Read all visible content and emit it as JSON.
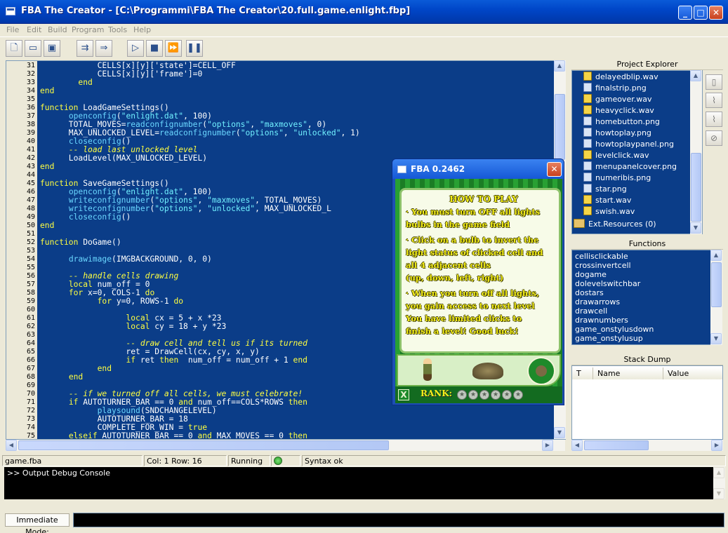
{
  "window": {
    "title": "FBA The Creator - [C:\\Programmi\\FBA The Creator\\20.full.game.enlight.fbp]",
    "min": "_",
    "max": "□",
    "close": "✕"
  },
  "menu": [
    "File",
    "Edit",
    "Build",
    "Program",
    "Tools",
    "Help"
  ],
  "toolbar": {
    "new": "new-file",
    "open": "open-folder",
    "save": "save",
    "step_into": "step-into",
    "step_over": "step-over",
    "run": "run",
    "stop": "stop",
    "fast_forward": "fast-forward",
    "pause": "pause"
  },
  "editor": {
    "lines": [
      {
        "n": "31",
        "indent": "            ",
        "text": "CELLS[x][y]['state']=CELL_OFF"
      },
      {
        "n": "32",
        "indent": "            ",
        "text": "CELLS[x][y]['frame']=0"
      },
      {
        "n": "33",
        "indent": "        ",
        "text": "end"
      },
      {
        "n": "34",
        "indent": "",
        "text": "end"
      },
      {
        "n": "35",
        "indent": "",
        "text": ""
      },
      {
        "n": "36",
        "indent": "",
        "text": "function LoadGameSettings()"
      },
      {
        "n": "37",
        "indent": "      ",
        "text": "openconfig(\"enlight.dat\", 100)"
      },
      {
        "n": "38",
        "indent": "      ",
        "text": "TOTAL_MOVES=readconfignumber(\"options\", \"maxmoves\", 0)"
      },
      {
        "n": "39",
        "indent": "      ",
        "text": "MAX_UNLOCKED_LEVEL=readconfignumber(\"options\", \"unlocked\", 1)"
      },
      {
        "n": "40",
        "indent": "      ",
        "text": "closeconfig()"
      },
      {
        "n": "41",
        "indent": "      ",
        "text": "-- load last unlocked level"
      },
      {
        "n": "42",
        "indent": "      ",
        "text": "LoadLevel(MAX_UNLOCKED_LEVEL)"
      },
      {
        "n": "43",
        "indent": "",
        "text": "end"
      },
      {
        "n": "44",
        "indent": "",
        "text": ""
      },
      {
        "n": "45",
        "indent": "",
        "text": "function SaveGameSettings()"
      },
      {
        "n": "46",
        "indent": "      ",
        "text": "openconfig(\"enlight.dat\", 100)"
      },
      {
        "n": "47",
        "indent": "      ",
        "text": "writeconfignumber(\"options\", \"maxmoves\", TOTAL_MOVES)"
      },
      {
        "n": "48",
        "indent": "      ",
        "text": "writeconfignumber(\"options\", \"unlocked\", MAX_UNLOCKED_L"
      },
      {
        "n": "49",
        "indent": "      ",
        "text": "closeconfig()"
      },
      {
        "n": "50",
        "indent": "",
        "text": "end"
      },
      {
        "n": "51",
        "indent": "",
        "text": ""
      },
      {
        "n": "52",
        "indent": "",
        "text": "function DoGame()"
      },
      {
        "n": "53",
        "indent": "",
        "text": ""
      },
      {
        "n": "54",
        "indent": "      ",
        "text": "drawimage(IMGBACKGROUND, 0, 0)"
      },
      {
        "n": "55",
        "indent": "",
        "text": ""
      },
      {
        "n": "56",
        "indent": "      ",
        "text": "-- handle cells drawing"
      },
      {
        "n": "57",
        "indent": "      ",
        "text": "local num_off = 0"
      },
      {
        "n": "58",
        "indent": "      ",
        "text": "for x=0, COLS-1 do"
      },
      {
        "n": "59",
        "indent": "            ",
        "text": "for y=0, ROWS-1 do"
      },
      {
        "n": "60",
        "indent": "",
        "text": ""
      },
      {
        "n": "61",
        "indent": "                  ",
        "text": "local cx = 5 + x *23"
      },
      {
        "n": "62",
        "indent": "                  ",
        "text": "local cy = 18 + y *23"
      },
      {
        "n": "63",
        "indent": "",
        "text": ""
      },
      {
        "n": "64",
        "indent": "                  ",
        "text": "-- draw cell and tell us if its turned"
      },
      {
        "n": "65",
        "indent": "                  ",
        "text": "ret = DrawCell(cx, cy, x, y)"
      },
      {
        "n": "66",
        "indent": "                  ",
        "text": "if ret then  num_off = num_off + 1 end"
      },
      {
        "n": "67",
        "indent": "            ",
        "text": "end"
      },
      {
        "n": "68",
        "indent": "      ",
        "text": "end"
      },
      {
        "n": "69",
        "indent": "",
        "text": ""
      },
      {
        "n": "70",
        "indent": "      ",
        "text": "-- if we turned off all cells, we must celebrate!"
      },
      {
        "n": "71",
        "indent": "      ",
        "text": "if AUTOTURNER_BAR == 0 and num_off==COLS*ROWS then"
      },
      {
        "n": "72",
        "indent": "            ",
        "text": "playsound(SNDCHANGELEVEL)"
      },
      {
        "n": "73",
        "indent": "            ",
        "text": "AUTOTURNER_BAR = 18"
      },
      {
        "n": "74",
        "indent": "            ",
        "text": "COMPLETE_FOR_WIN = true"
      },
      {
        "n": "75",
        "indent": "      ",
        "text": "elseif AUTOTURNER_BAR == 0 and MAX_MOVES == 0 then"
      }
    ]
  },
  "project_explorer": {
    "title": "Project Explorer",
    "items": [
      {
        "name": "delayedblip.wav",
        "type": "wav"
      },
      {
        "name": "finalstrip.png",
        "type": "png"
      },
      {
        "name": "gameover.wav",
        "type": "wav"
      },
      {
        "name": "heavyclick.wav",
        "type": "wav"
      },
      {
        "name": "homebutton.png",
        "type": "png"
      },
      {
        "name": "howtoplay.png",
        "type": "png"
      },
      {
        "name": "howtoplaypanel.png",
        "type": "png"
      },
      {
        "name": "levelclick.wav",
        "type": "wav"
      },
      {
        "name": "menupanelcover.png",
        "type": "png"
      },
      {
        "name": "numeribis.png",
        "type": "png"
      },
      {
        "name": "star.png",
        "type": "png"
      },
      {
        "name": "start.wav",
        "type": "wav"
      },
      {
        "name": "swish.wav",
        "type": "wav"
      }
    ],
    "folder": "Ext.Resources (0)"
  },
  "functions": {
    "title": "Functions",
    "items": [
      "cellisclickable",
      "crossinvertcell",
      "dogame",
      "dolevelswitchbar",
      "dostars",
      "drawarrows",
      "drawcell",
      "drawnumbers",
      "game_onstylusdown",
      "game_onstylusup"
    ]
  },
  "stack_dump": {
    "title": "Stack Dump",
    "columns": [
      "T",
      "Name",
      "Value"
    ]
  },
  "status": {
    "file": "game.fba",
    "position": "Col: 1 Row: 16",
    "state": "Running",
    "syntax": "Syntax ok"
  },
  "console": {
    "text": ">> Output Debug Console"
  },
  "immediate": {
    "label": "Immediate Mode:"
  },
  "popup": {
    "title": "FBA 0.2462",
    "heading": "HOW TO PLAY",
    "lines": [
      "· You must turn OFF all lights",
      "  bulbs in the game field",
      "· Click on a bulb to invert the",
      "  light status of clicked cell and",
      "  all 4 adjacent cells",
      "  (up, down, left, right)",
      "· When you turn off all lights,",
      "  you gain access to next level",
      "  You have limited clicks to",
      "  finish a level! Good luck!"
    ],
    "rank_label": "RANK:",
    "stars": 6,
    "close_label": "X"
  }
}
